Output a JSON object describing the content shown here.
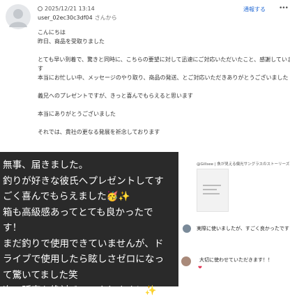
{
  "review": {
    "date": "2025/12/21 13:14",
    "username": "user_02ec30c3df04",
    "username_suffix": "さんから",
    "report_label": "通報する",
    "more_icon": "ellipsis-icon",
    "lines": [
      "こんにちは",
      "昨日、商品を受取りました",
      "",
      "とても早い到着で、驚きと同時に、こちらの要望に対して迅速にご対応いただいたこと、感謝していま",
      "す",
      "本当にお忙しい中、メッセージのやり取り、商品の発送、とご対応いただきありがとうございました",
      "",
      "義兄へのプレゼントですが、きっと喜んでもらえると思います",
      "",
      "本当にありがとうございました",
      "",
      "それでは、貴社の更なる発展を祈念しております"
    ]
  },
  "dark_message": {
    "lines": [
      "無事、届きました。",
      "釣りが好きな彼氏へプレゼントしてす",
      "ごく喜んでもらえました🥳✨",
      "箱も高級感あってとても良かったで",
      "す！",
      "まだ釣りで使用できていませんが、ド",
      "ライブで使用したら眩しさゼロになっ",
      "て驚いてました笑",
      "次の販売も絶対チェックします！✨"
    ]
  },
  "social": {
    "header": "@Gillsee | 魚が見える偏光サングラスのストーリーズに返",
    "comment1": "実際に使いましたが、すごく良かったです！",
    "comment2": "大切に使わせていただきます！！",
    "heart": "❤"
  }
}
